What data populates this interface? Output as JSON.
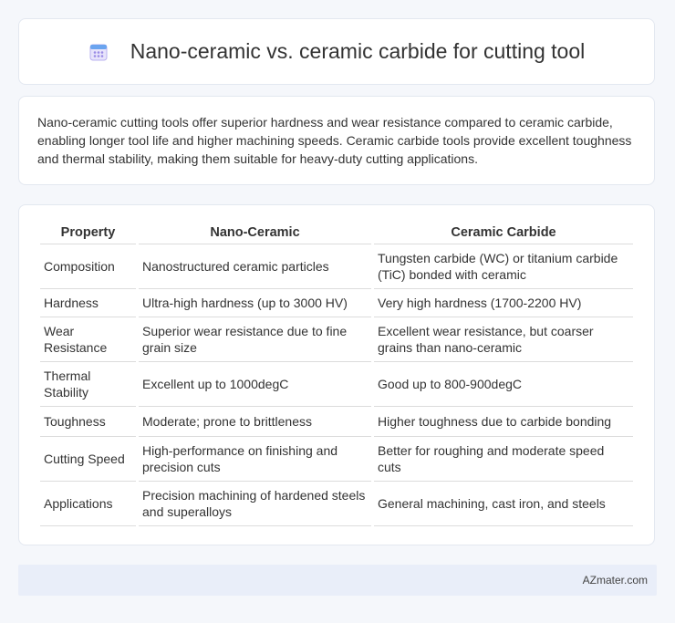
{
  "header": {
    "title": "Nano-ceramic vs. ceramic carbide for cutting tool",
    "icon": "calendar-icon"
  },
  "summary": "Nano-ceramic cutting tools offer superior hardness and wear resistance compared to ceramic carbide, enabling longer tool life and higher machining speeds. Ceramic carbide tools provide excellent toughness and thermal stability, making them suitable for heavy-duty cutting applications.",
  "table": {
    "headers": [
      "Property",
      "Nano-Ceramic",
      "Ceramic Carbide"
    ],
    "rows": [
      [
        "Composition",
        "Nanostructured ceramic particles",
        "Tungsten carbide (WC) or titanium carbide (TiC) bonded with ceramic"
      ],
      [
        "Hardness",
        "Ultra-high hardness (up to 3000 HV)",
        "Very high hardness (1700-2200 HV)"
      ],
      [
        "Wear Resistance",
        "Superior wear resistance due to fine grain size",
        "Excellent wear resistance, but coarser grains than nano-ceramic"
      ],
      [
        "Thermal Stability",
        "Excellent up to 1000degC",
        "Good up to 800-900degC"
      ],
      [
        "Toughness",
        "Moderate; prone to brittleness",
        "Higher toughness due to carbide bonding"
      ],
      [
        "Cutting Speed",
        "High-performance on finishing and precision cuts",
        "Better for roughing and moderate speed cuts"
      ],
      [
        "Applications",
        "Precision machining of hardened steels and superalloys",
        "General machining, cast iron, and steels"
      ]
    ]
  },
  "footer": {
    "brand": "AZmater.com"
  }
}
